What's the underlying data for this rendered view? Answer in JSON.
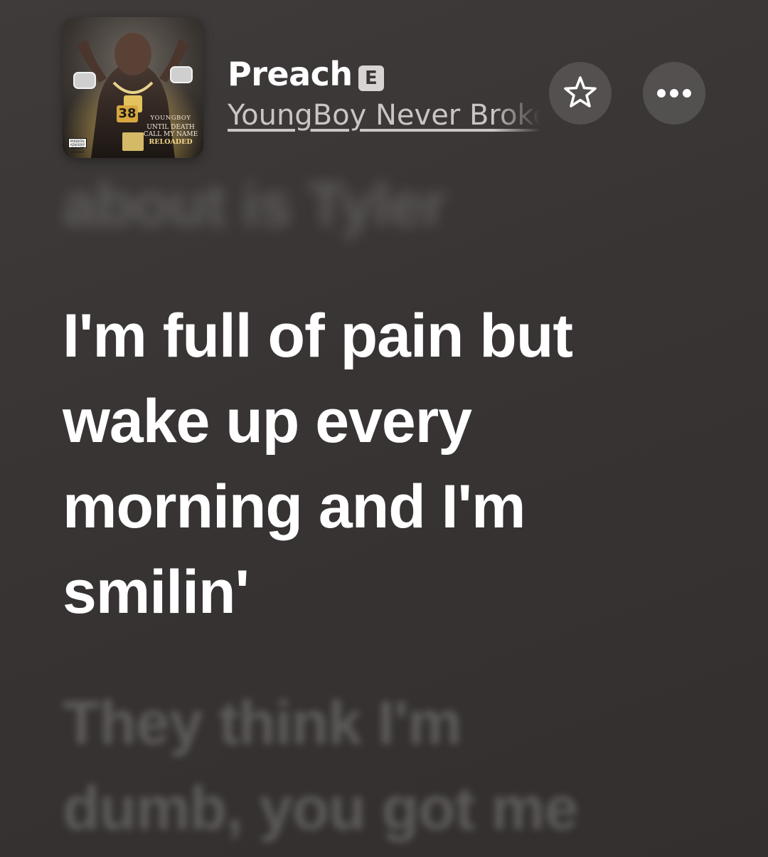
{
  "colors": {
    "background": "#383434",
    "title_text": "#ffffff",
    "artist_text": "#c9c5c4",
    "button_fill": "rgba(255,255,255,0.13)",
    "accent_gold": "#d7a640"
  },
  "now_playing": {
    "title": "Preach",
    "explicit_badge": "E",
    "artist": "YoungBoy Never Broke Again",
    "artwork": {
      "badge_number": "38",
      "artist_text": "YOUNGBOY",
      "line1": "UNTIL DEATH",
      "line2": "CALL MY NAME",
      "line3": "RELOADED",
      "advisory": "PARENTAL ADVISORY EXPLICIT CONTENT"
    }
  },
  "controls": {
    "favorite_icon": "star-outline-icon",
    "more_icon": "ellipsis-icon"
  },
  "lyrics": {
    "previous": [
      "about is Tyler"
    ],
    "current": [
      "I'm full of pain but",
      "wake up every",
      "morning and I'm",
      "smilin'"
    ],
    "next": [
      "They think I'm",
      "dumb, you got me"
    ]
  }
}
